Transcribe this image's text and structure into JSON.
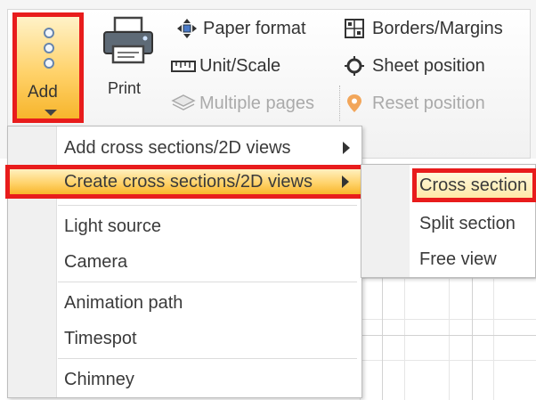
{
  "ribbon": {
    "add_label": "Add",
    "print_label": "Print",
    "items": {
      "paper_format": "Paper format",
      "unit_scale": "Unit/Scale",
      "multiple_pages": "Multiple pages",
      "borders_margins": "Borders/Margins",
      "sheet_position": "Sheet position",
      "reset_position": "Reset position"
    }
  },
  "add_menu": {
    "items": [
      {
        "label": "Add cross sections/2D views",
        "has_submenu": true
      },
      {
        "label": "Create cross sections/2D views",
        "has_submenu": true,
        "highlighted": true
      },
      {
        "label": "Light source"
      },
      {
        "label": "Camera"
      },
      {
        "label": "Animation path"
      },
      {
        "label": "Timespot"
      },
      {
        "label": "Chimney"
      }
    ]
  },
  "submenu": {
    "items": [
      {
        "label": "Cross section",
        "highlighted": true
      },
      {
        "label": "Split section"
      },
      {
        "label": "Free view"
      }
    ]
  },
  "colors": {
    "highlight_border": "#e81c1c",
    "hover_gradient_top": "#fff0c0",
    "hover_gradient_bottom": "#f8b52a"
  }
}
